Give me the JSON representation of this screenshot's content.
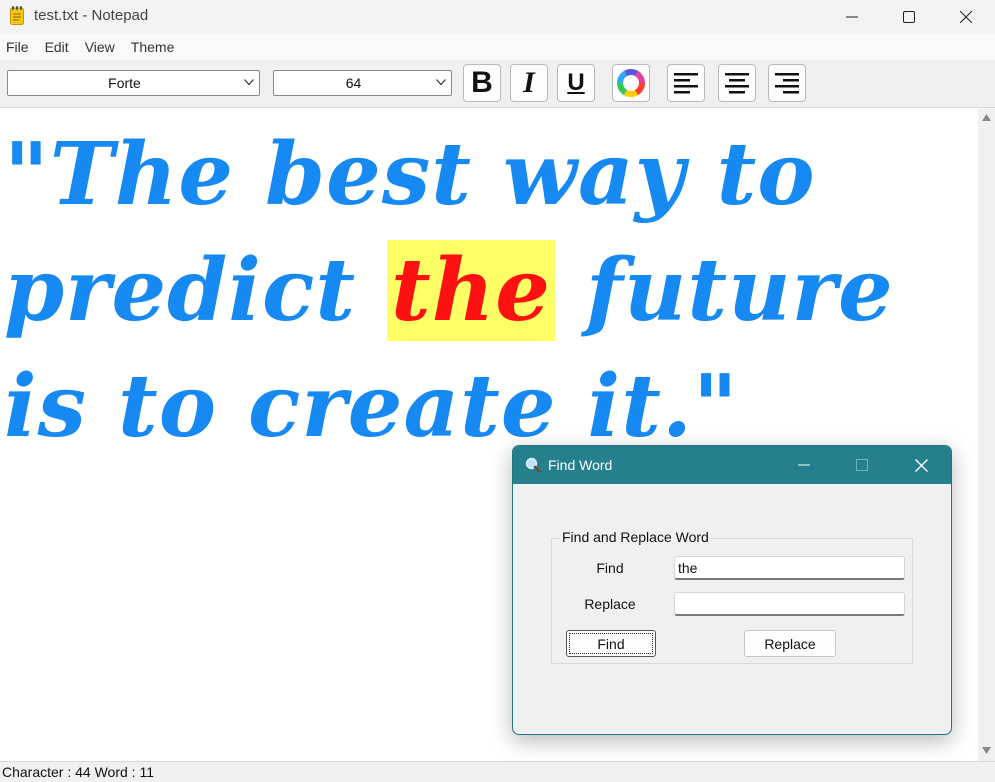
{
  "window": {
    "title": "test.txt - Notepad",
    "icon": "notepad-icon",
    "controls": {
      "minimize": "minimize-icon",
      "maximize": "maximize-icon",
      "close": "close-icon"
    }
  },
  "menu": {
    "items": [
      "File",
      "Edit",
      "View",
      "Theme"
    ]
  },
  "toolbar": {
    "font_name": "Forte",
    "font_size": "64",
    "bold": "B",
    "italic": "I",
    "underline": "U",
    "color_icon": "color-wheel-icon",
    "align_icons": [
      "align-left-icon",
      "align-center-icon",
      "align-right-icon"
    ]
  },
  "editor": {
    "text_before": "\"The best way to predict ",
    "highlight": "the",
    "text_after": " future is to create it.\"",
    "text_color": "#1689f2",
    "highlight_bg": "#ffff66",
    "highlight_color": "#ff1111"
  },
  "status": {
    "text": "Character : 44  Word : 11"
  },
  "dialog": {
    "title": "Find Word",
    "title_icon": "search-icon",
    "title_bg": "#257f8c",
    "group_label": "Find and Replace Word",
    "find_label": "Find",
    "find_value": "the",
    "replace_label": "Replace",
    "replace_value": "",
    "find_button": "Find",
    "replace_button": "Replace"
  }
}
